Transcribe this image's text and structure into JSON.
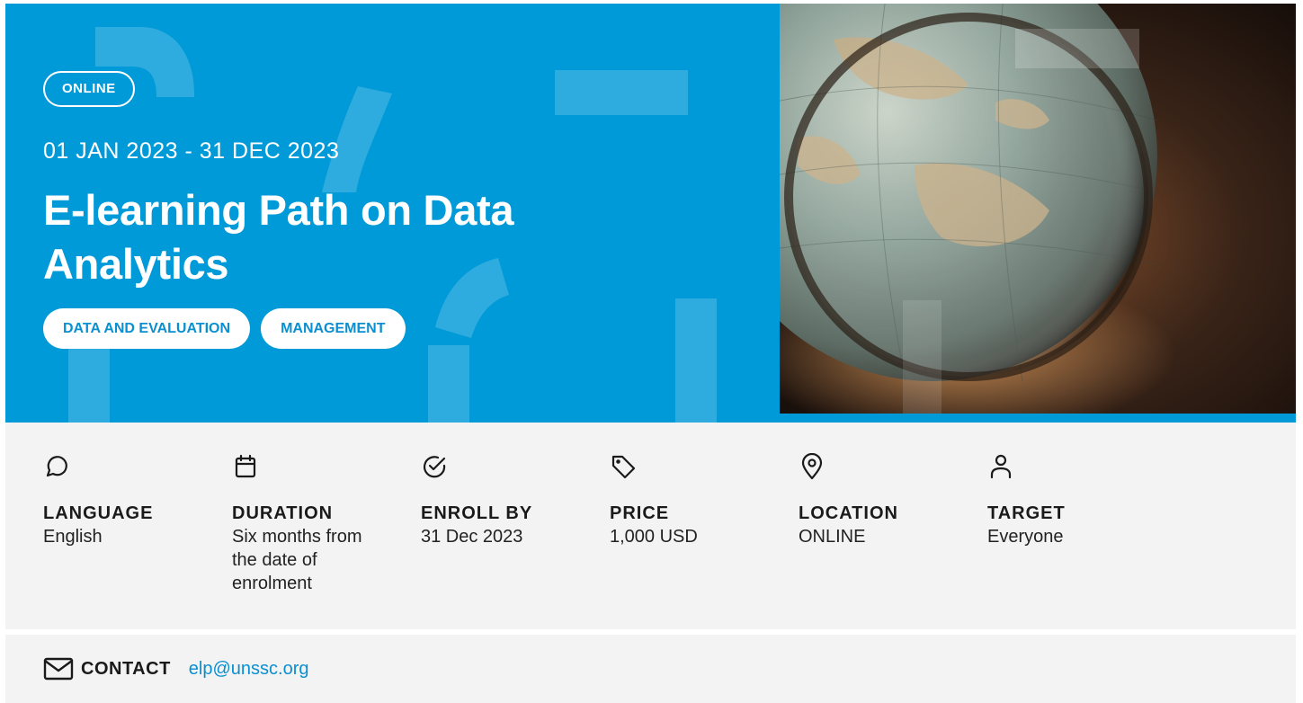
{
  "hero": {
    "badge": "ONLINE",
    "dates": "01 JAN 2023 - 31 DEC 2023",
    "title": "E-learning Path on Data Analytics",
    "tags": [
      "DATA AND EVALUATION",
      "MANAGEMENT"
    ],
    "accent_color": "#019ad8",
    "photo": "globe behind magnifying glass"
  },
  "info": [
    {
      "icon": "speech-bubble-icon",
      "label": "LANGUAGE",
      "value": "English"
    },
    {
      "icon": "calendar-icon",
      "label": "DURATION",
      "value": "Six months from the date of enrolment"
    },
    {
      "icon": "check-circle-icon",
      "label": "ENROLL BY",
      "value": "31 Dec 2023"
    },
    {
      "icon": "price-tag-icon",
      "label": "PRICE",
      "value": "1,000 USD"
    },
    {
      "icon": "map-pin-icon",
      "label": "LOCATION",
      "value": "ONLINE"
    },
    {
      "icon": "person-icon",
      "label": "TARGET",
      "value": "Everyone"
    }
  ],
  "contact": {
    "icon": "envelope-icon",
    "label": "CONTACT",
    "email": "elp@unssc.org"
  }
}
